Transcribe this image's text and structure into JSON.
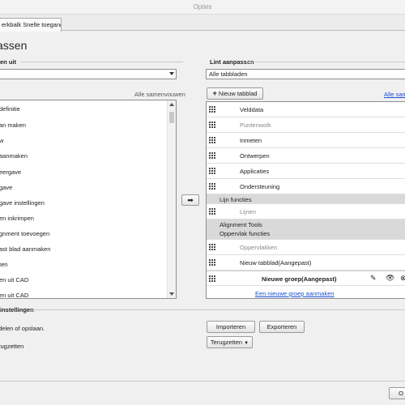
{
  "window": {
    "title": "Opties"
  },
  "tabs": [
    {
      "label": "erkbalk Snelle toegang"
    }
  ],
  "page": {
    "heading": "assen"
  },
  "left": {
    "section_label": "en uit",
    "combo_value": "",
    "collapse_all": "Alle samenvouwen",
    "items": [
      "definitie",
      "an maken",
      "w",
      "aanmaken",
      "eergave",
      "gave",
      "gave instellingen",
      "en inkrimpen",
      "gnment toevoegen",
      "ast blad aanmaken",
      "ten",
      "en uit CAD",
      "en uit CAD"
    ]
  },
  "right": {
    "section_label": "Lint aanpassen",
    "combo_value": "Alle tabbladen",
    "new_tab_button": "Nieuw tabblad",
    "expand_all": "Alle sam",
    "rows": [
      {
        "kind": "item",
        "label": "Velddata",
        "dim": false
      },
      {
        "kind": "item",
        "label": "Puntenwolk",
        "dim": true
      },
      {
        "kind": "item",
        "label": "Inmeten",
        "dim": false
      },
      {
        "kind": "item",
        "label": "Ontwerpen",
        "dim": false
      },
      {
        "kind": "item",
        "label": "Applicaties",
        "dim": false
      },
      {
        "kind": "item",
        "label": "Ondersteuning",
        "dim": false
      },
      {
        "kind": "group",
        "label": "Lijn functies"
      },
      {
        "kind": "item",
        "label": "Lijnen",
        "dim": true
      },
      {
        "kind": "group2",
        "label": "Alignment Tools",
        "label2": "Oppervlak functies"
      },
      {
        "kind": "item",
        "label": "Oppervlakken",
        "dim": true
      },
      {
        "kind": "item",
        "label": "Nieuw tabblad(Aangepast)",
        "dim": false
      },
      {
        "kind": "selected",
        "label": "Nieuwe groep(Aangepast)"
      }
    ],
    "new_group_link": "Een nieuwe groep aanmaken"
  },
  "arrow_button": "➡",
  "settings": {
    "section_label": "instellingen",
    "share_text": "delen of opslaan.",
    "reset_text": "rugzetten",
    "import_button": "Importeren",
    "export_button": "Exporteren",
    "reset_button": "Terugzetten"
  },
  "footer": {
    "button": "O"
  }
}
